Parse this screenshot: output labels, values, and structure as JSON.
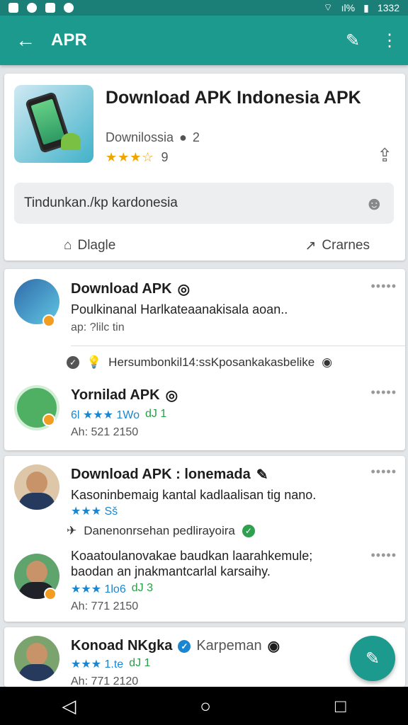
{
  "status": {
    "time": "1332",
    "battery": "ıl%"
  },
  "appbar": {
    "title": "APR"
  },
  "hero": {
    "title": "Download APK Indonesia APK",
    "developer": "Downilossia",
    "reviews": "2",
    "rating_count": "9",
    "search_value": "Tindunkan./kp kardonesia",
    "action_left": "Dlagle",
    "action_right": "Crarnes"
  },
  "items": [
    {
      "title": "Download APK",
      "line": "Poulkinanal Harlkateaanakisala aoan..",
      "meta": "ap: ?lilc tin"
    },
    {
      "notice": "Hersumbonkil14:ssKposankakasbelike"
    },
    {
      "title": "Yornilad APK",
      "stars_text": "6l ★★★ 1Wo",
      "count": "dJ 1",
      "meta": "Ah: 521 2150"
    },
    {
      "title": "Download APK : lonemada",
      "line": "Kasoninbemaig kantal kadlaalisan tig nano.",
      "stars_text": "★★★ Sš"
    },
    {
      "notice": "Danenonrsehan pedlirayoira"
    },
    {
      "line1": "Koaatoulanovakae baudkan laarahkemule;",
      "line2": "baodan an jnakmantcarlal karsaihy.",
      "stars_text": "★★★ 1lo6",
      "count": "dJ 3",
      "meta": "Ah: 771 2150"
    },
    {
      "title": "Konoad NKgka",
      "sub": "Karpeman",
      "stars_text": "★★★ 1.te",
      "count": "dJ 1",
      "meta": "Ah: 771 2120"
    }
  ]
}
